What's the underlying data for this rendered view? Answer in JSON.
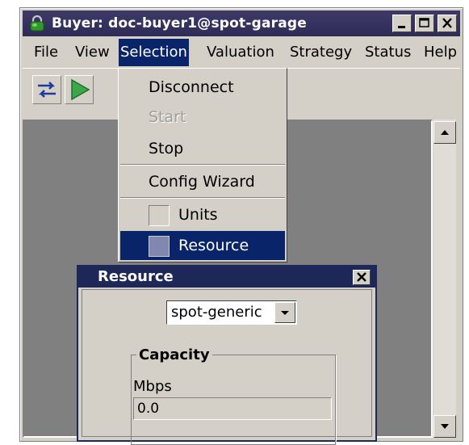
{
  "window": {
    "title": "Buyer: doc-buyer1@spot-garage"
  },
  "menubar": {
    "items": [
      "File",
      "View",
      "Selection",
      "Valuation",
      "Strategy",
      "Status",
      "Help"
    ],
    "active": "Selection"
  },
  "selection_menu": {
    "disconnect": "Disconnect",
    "start": "Start",
    "stop": "Stop",
    "config_wizard": "Config Wizard",
    "units": "Units",
    "resource": "Resource"
  },
  "resource_frame": {
    "title": "Resource",
    "combo_value": "spot-generic",
    "group_title": "Capacity",
    "field_label": "Mbps",
    "field_value": "0.0"
  },
  "colors": {
    "titlebar": "#3e3a68",
    "menu_highlight": "#0a246a",
    "desktop": "#808080",
    "window_face": "#d4d0c8",
    "play_green": "#3aa84a"
  },
  "icons": {
    "app": "green-lock-icon",
    "swap": "swap-arrows-icon",
    "play": "play-icon"
  }
}
